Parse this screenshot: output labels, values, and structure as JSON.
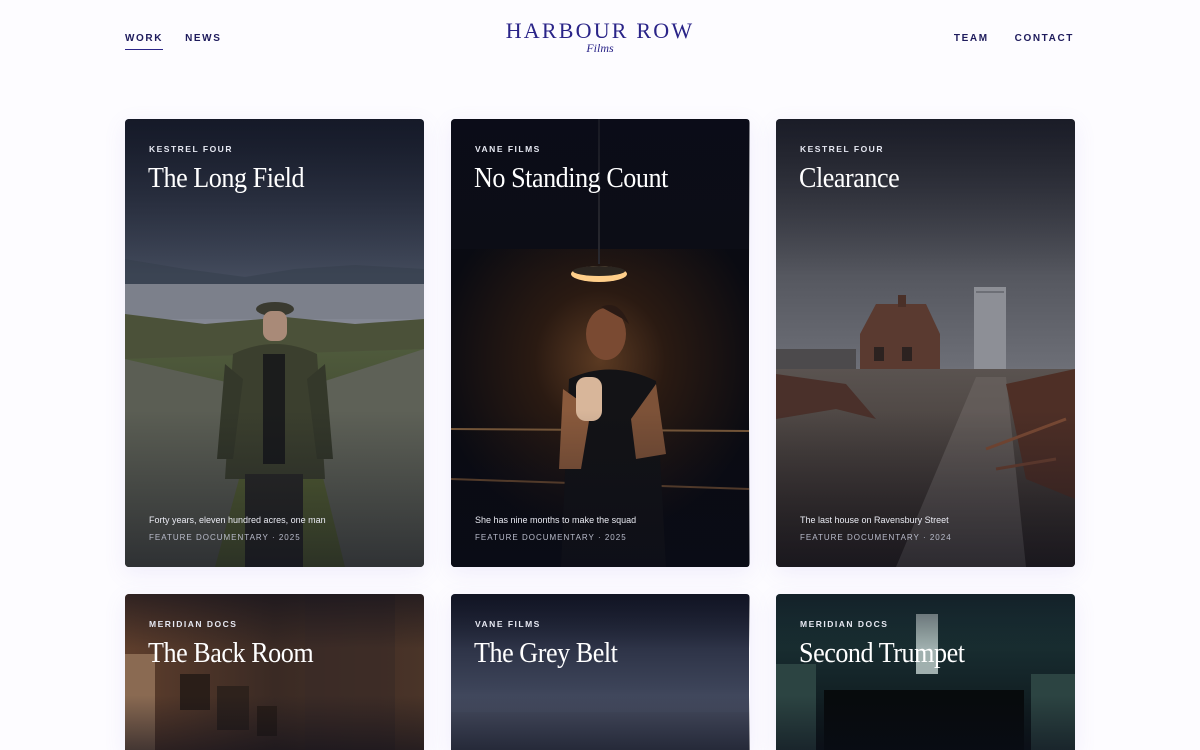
{
  "nav": {
    "left": [
      {
        "label": "WORK",
        "active": true
      },
      {
        "label": "NEWS",
        "active": false
      }
    ],
    "right": [
      {
        "label": "TEAM"
      },
      {
        "label": "CONTACT"
      }
    ]
  },
  "brand": {
    "name": "HARBOUR ROW",
    "sub": "Films"
  },
  "films": [
    {
      "studio": "KESTREL FOUR",
      "title": "The Long Field",
      "tagline": "Forty years, eleven hundred acres, one man",
      "meta": "FEATURE DOCUMENTARY · 2025"
    },
    {
      "studio": "VANE FILMS",
      "title": "No Standing Count",
      "tagline": "She has nine months to make the squad",
      "meta": "FEATURE DOCUMENTARY · 2025"
    },
    {
      "studio": "KESTREL FOUR",
      "title": "Clearance",
      "tagline": "The last house on Ravensbury Street",
      "meta": "FEATURE DOCUMENTARY · 2024"
    },
    {
      "studio": "MERIDIAN DOCS",
      "title": "The Back Room"
    },
    {
      "studio": "VANE FILMS",
      "title": "The Grey Belt"
    },
    {
      "studio": "MERIDIAN DOCS",
      "title": "Second Trumpet"
    }
  ],
  "colors": {
    "accent": "#2a2488",
    "background": "#fdfcff"
  }
}
